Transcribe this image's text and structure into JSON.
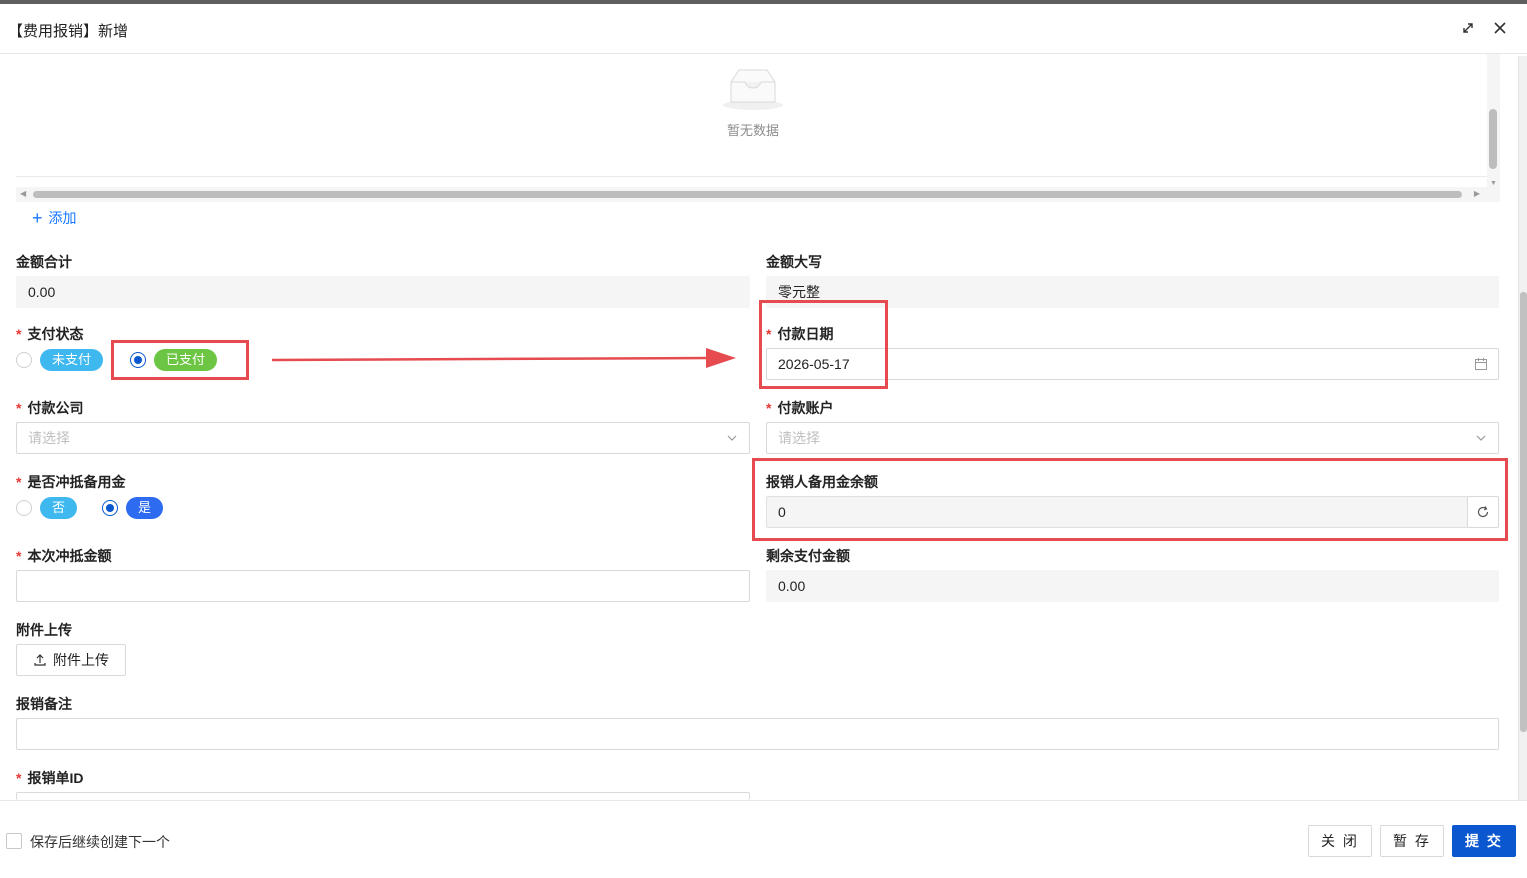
{
  "dialog": {
    "title": "【费用报销】新增"
  },
  "table": {
    "empty_text": "暂无数据",
    "add_label": "添加"
  },
  "form": {
    "amount_total": {
      "label": "金额合计",
      "value": "0.00"
    },
    "amount_upper": {
      "label": "金额大写",
      "value": "零元整"
    },
    "pay_status": {
      "label": "支付状态",
      "options": [
        "未支付",
        "已支付"
      ],
      "selected": "已支付"
    },
    "pay_date": {
      "label": "付款日期",
      "value": "2026-05-17"
    },
    "pay_company": {
      "label": "付款公司",
      "placeholder": "请选择"
    },
    "pay_account": {
      "label": "付款账户",
      "placeholder": "请选择"
    },
    "offset_reserve": {
      "label": "是否冲抵备用金",
      "options": [
        "否",
        "是"
      ],
      "selected": "是"
    },
    "reserve_balance": {
      "label": "报销人备用金余额",
      "value": "0"
    },
    "offset_amount": {
      "label": "本次冲抵金额",
      "value": ""
    },
    "remaining": {
      "label": "剩余支付金额",
      "value": "0.00"
    },
    "attachment": {
      "label": "附件上传",
      "button": "附件上传"
    },
    "remark": {
      "label": "报销备注",
      "value": ""
    },
    "bill_id": {
      "label": "报销单ID"
    }
  },
  "footer": {
    "continue_label": "保存后继续创建下一个",
    "close": "关 闭",
    "draft": "暂 存",
    "submit": "提 交"
  },
  "colors": {
    "primary": "#0b57d0",
    "tag_unpaid": "#3fb8ef",
    "tag_paid": "#6cc644",
    "tag_no": "#3fb8ef",
    "tag_yes": "#2d6bf0",
    "annotation": "#e54b4f",
    "required": "#e53935"
  }
}
